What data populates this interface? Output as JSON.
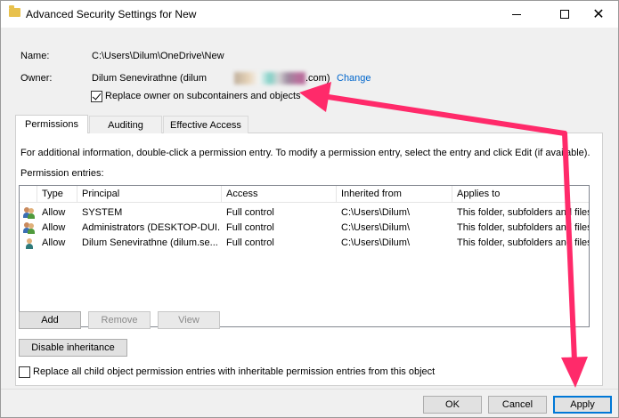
{
  "window": {
    "title": "Advanced Security Settings for New"
  },
  "info": {
    "name_label": "Name:",
    "name_value": "C:\\Users\\Dilum\\OneDrive\\New",
    "owner_label": "Owner:",
    "owner_prefix": "Dilum Senevirathne (dilum",
    "owner_suffix": ".com)",
    "change_link": "Change",
    "replace_owner_label": "Replace owner on subcontainers and objects",
    "replace_owner_checked": true
  },
  "tabs": [
    {
      "label": "Permissions",
      "active": true
    },
    {
      "label": "Auditing",
      "active": false
    },
    {
      "label": "Effective Access",
      "active": false
    }
  ],
  "panel": {
    "info_text": "For additional information, double-click a permission entry. To modify a permission entry, select the entry and click Edit (if available).",
    "entries_label": "Permission entries:"
  },
  "table": {
    "columns": [
      "Type",
      "Principal",
      "Access",
      "Inherited from",
      "Applies to"
    ],
    "rows": [
      {
        "icon": "group-users-icon",
        "type": "Allow",
        "principal": "SYSTEM",
        "access": "Full control",
        "inherited": "C:\\Users\\Dilum\\",
        "applies": "This folder, subfolders and files"
      },
      {
        "icon": "group-users-icon",
        "type": "Allow",
        "principal": "Administrators (DESKTOP-DUI...",
        "access": "Full control",
        "inherited": "C:\\Users\\Dilum\\",
        "applies": "This folder, subfolders and files"
      },
      {
        "icon": "user-icon",
        "type": "Allow",
        "principal": "Dilum Senevirathne (dilum.se...",
        "access": "Full control",
        "inherited": "C:\\Users\\Dilum\\",
        "applies": "This folder, subfolders and files"
      }
    ]
  },
  "buttons": {
    "add": "Add",
    "remove": "Remove",
    "view": "View",
    "disable_inheritance": "Disable inheritance",
    "ok": "OK",
    "cancel": "Cancel",
    "apply": "Apply"
  },
  "replace_child": {
    "label": "Replace all child object permission entries with inheritable permission entries from this object",
    "checked": false
  },
  "colors": {
    "arrow": "#ff2a6a",
    "link": "#0066cc",
    "accent": "#0078d7"
  }
}
